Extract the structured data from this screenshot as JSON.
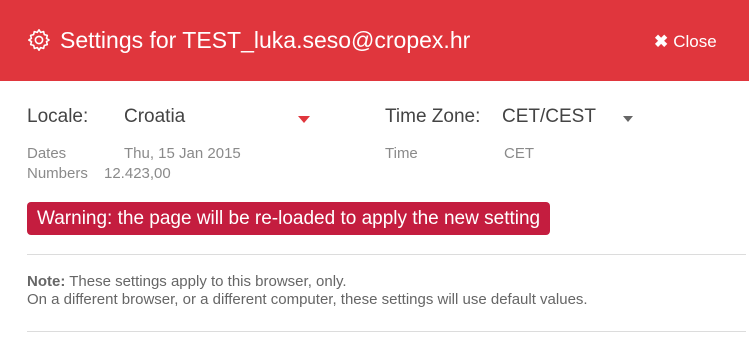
{
  "header": {
    "title": "Settings for TEST_luka.seso@cropex.hr",
    "close_label": "Close",
    "close_glyph": "✖",
    "bg_color": "#e0363d"
  },
  "locale": {
    "label": "Locale:",
    "value": "Croatia",
    "dates_label": "Dates",
    "dates_value": "Thu, 15 Jan 2015",
    "numbers_label": "Numbers",
    "numbers_value": "12.423,00"
  },
  "timezone": {
    "label": "Time Zone:",
    "value": "CET/CEST",
    "time_label": "Time",
    "time_value": "CET"
  },
  "warning": {
    "text": "Warning: the page will be re-loaded to apply the new setting",
    "color": "#c41d3f"
  },
  "note": {
    "bold": "Note:",
    "line1": "These settings apply to this browser, only.",
    "line2": "On a different browser, or a different computer, these settings will use default values."
  }
}
